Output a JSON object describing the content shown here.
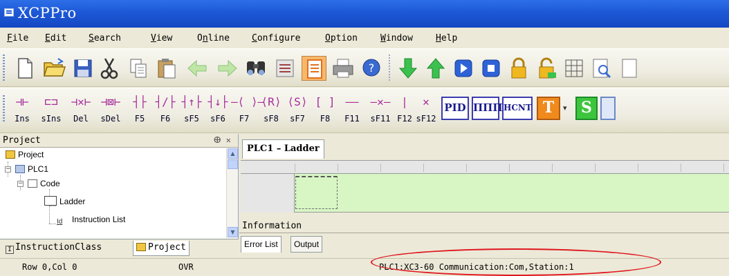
{
  "window": {
    "title": "XCPPro"
  },
  "menu": [
    {
      "pre": "",
      "ul": "F",
      "post": "ile"
    },
    {
      "pre": "",
      "ul": "E",
      "post": "dit"
    },
    {
      "pre": "",
      "ul": "S",
      "post": "earch"
    },
    {
      "pre": "",
      "ul": "V",
      "post": "iew"
    },
    {
      "pre": "O",
      "ul": "n",
      "post": "line"
    },
    {
      "pre": "",
      "ul": "C",
      "post": "onfigure"
    },
    {
      "pre": "",
      "ul": "O",
      "post": "ption"
    },
    {
      "pre": "",
      "ul": "W",
      "post": "indow"
    },
    {
      "pre": "",
      "ul": "H",
      "post": "elp"
    }
  ],
  "toolbar": {
    "buttons": [
      "new-file-icon",
      "open-folder-icon",
      "save-icon",
      "cut-icon",
      "copy-icon",
      "paste-icon",
      "back-arrow-icon",
      "forward-arrow-icon",
      "find-icon",
      "keyboard-icon",
      "ladder-view-icon",
      "print-icon",
      "help-icon",
      "download-icon",
      "upload-icon",
      "run-icon",
      "stop-icon",
      "lock-icon",
      "unlock-icon",
      "monitor-icon",
      "preview-icon"
    ]
  },
  "ladder_toolbar": {
    "items": [
      {
        "glyph": "⊣⊢",
        "label": "Ins"
      },
      {
        "glyph": "⊏⊐",
        "label": "sIns"
      },
      {
        "glyph": "⊣✕⊢",
        "label": "Del"
      },
      {
        "glyph": "⊣⊠⊢",
        "label": "sDel"
      },
      {
        "glyph": "┤├",
        "label": "F5"
      },
      {
        "glyph": "┤/├",
        "label": "F6"
      },
      {
        "glyph": "┤↑├",
        "label": "sF5"
      },
      {
        "glyph": "┤↓├",
        "label": "sF6"
      },
      {
        "glyph": "—⟨ ⟩—",
        "label": "F7"
      },
      {
        "glyph": "⟨R⟩",
        "label": "sF8"
      },
      {
        "glyph": "⟨S⟩",
        "label": "sF7"
      },
      {
        "glyph": "[  ]",
        "label": "F8"
      },
      {
        "glyph": "——",
        "label": "F11"
      },
      {
        "glyph": "—✕—",
        "label": "sF11"
      },
      {
        "glyph": "|",
        "label": "F12"
      },
      {
        "glyph": "✕",
        "label": "sF12"
      }
    ],
    "pid": "PID",
    "pulse": "ΠΠΠ",
    "hcnt": "HCNT",
    "t": "T",
    "s": "S",
    "colors": {
      "t_bg": "#f08a1c",
      "s_bg": "#3dc63d",
      "glyph": "#a52a9a"
    }
  },
  "project_pane": {
    "title": "Project",
    "tree": [
      {
        "label": "Project"
      },
      {
        "label": "PLC1"
      },
      {
        "label": "Code"
      },
      {
        "label": "Ladder"
      },
      {
        "label": "Instruction List"
      }
    ],
    "tabs": [
      "InstructionClass",
      "Project"
    ]
  },
  "editor": {
    "tab": "PLC1 – Ladder"
  },
  "information": {
    "title": "Information",
    "tabs": [
      "Error List",
      "Output"
    ]
  },
  "status": {
    "position": "Row 0,Col 0",
    "mode": "OVR",
    "comm": "PLC1:XC3-60 Communication:Com,Station:1"
  },
  "colors": {
    "titlebar": "#1d58d6",
    "ladder_bg": "#d7f6c4",
    "highlight": "#e0141c"
  }
}
